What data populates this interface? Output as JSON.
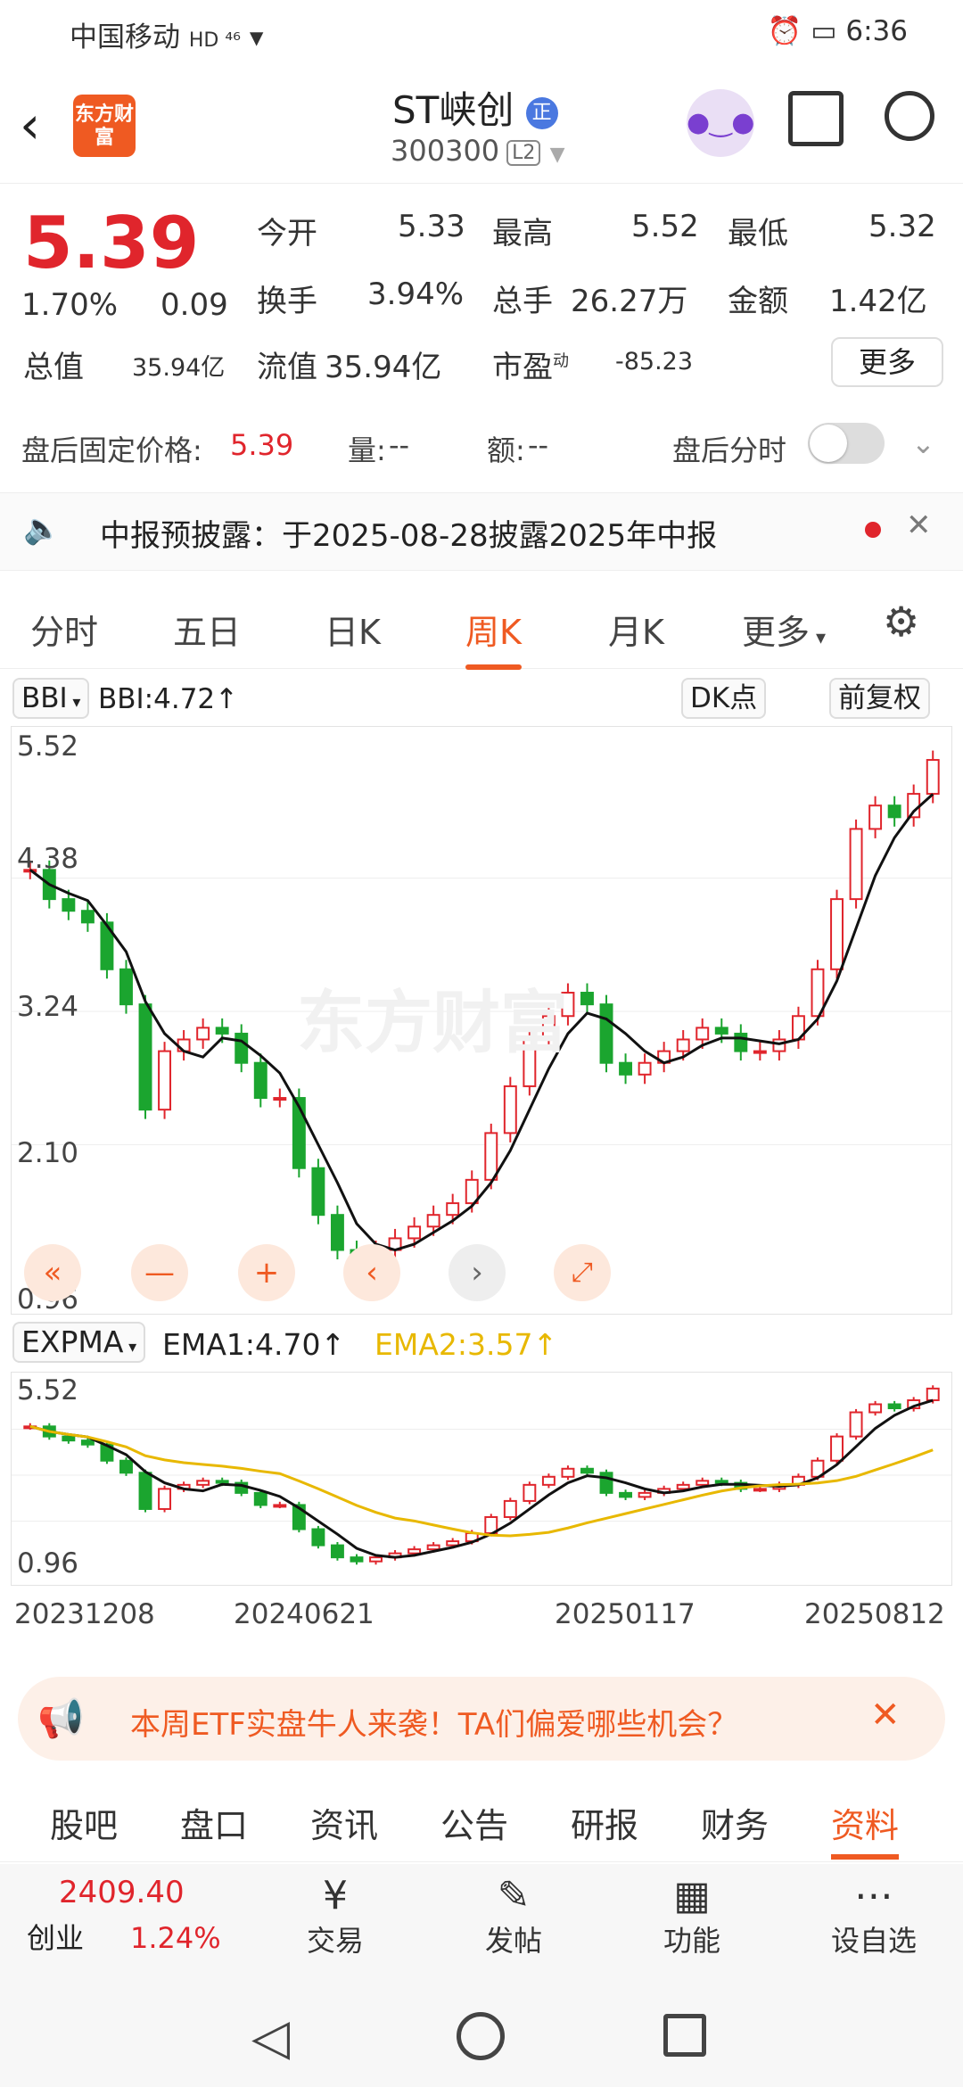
{
  "status_bar": {
    "carrier": "中国移动",
    "net": "HD ⁴⁶",
    "time": "6:36"
  },
  "header": {
    "logo_text": "东方财富",
    "stock_name": "ST峡创",
    "badge": "正",
    "stock_code": "300300",
    "level": "L2"
  },
  "quote": {
    "price": "5.39",
    "change_pct": "1.70%",
    "change_amt": "0.09",
    "open_label": "今开",
    "open": "5.33",
    "high_label": "最高",
    "high": "5.52",
    "low_label": "最低",
    "low": "5.32",
    "turnover_label": "换手",
    "turnover": "3.94%",
    "volume_label": "总手",
    "volume": "26.27万",
    "amount_label": "金额",
    "amount": "1.42亿",
    "mktcap_label": "总值",
    "mktcap": "35.94亿",
    "float_label": "流值",
    "float": "35.94亿",
    "pe_label": "市盈",
    "pe_sup": "动",
    "pe": "-85.23",
    "more": "更多"
  },
  "after_hours": {
    "label": "盘后固定价格:",
    "price": "5.39",
    "vol_label": "量:",
    "vol": "--",
    "amt_label": "额:",
    "amt": "--",
    "toggle_label": "盘后分时"
  },
  "notice": {
    "text": "中报预披露：于2025-08-28披露2025年中报"
  },
  "tabs": [
    "分时",
    "五日",
    "日K",
    "周K",
    "月K",
    "更多"
  ],
  "active_tab": "周K",
  "chart1": {
    "indicator": "BBI",
    "value_text": "BBI:4.72↑",
    "dk": "DK点",
    "adjust": "前复权",
    "ticks": [
      "5.52",
      "4.38",
      "3.24",
      "2.10",
      "0.96"
    ],
    "watermark": "东方财富"
  },
  "chart2": {
    "indicator": "EXPMA",
    "ema1": "EMA1:4.70↑",
    "ema2": "EMA2:3.57↑",
    "ticks": [
      "5.52",
      "0.96"
    ],
    "ema2_color": "#e8b800"
  },
  "dates": [
    "20231208",
    "20240621",
    "20250117",
    "20250812"
  ],
  "chart_data": {
    "type": "candlestick",
    "ylim": [
      0.96,
      5.52
    ],
    "bbi_last": 4.72,
    "ema1_last": 4.7,
    "ema2_last": 3.57,
    "close_path": [
      4.45,
      4.2,
      4.1,
      4.0,
      3.6,
      3.3,
      2.4,
      2.9,
      3.0,
      3.1,
      3.05,
      2.8,
      2.5,
      2.5,
      1.9,
      1.5,
      1.2,
      1.1,
      1.2,
      1.3,
      1.4,
      1.5,
      1.6,
      1.8,
      2.2,
      2.6,
      3.0,
      3.2,
      3.4,
      3.3,
      2.8,
      2.7,
      2.8,
      2.9,
      3.0,
      3.1,
      3.05,
      2.9,
      2.9,
      3.0,
      3.2,
      3.6,
      4.2,
      4.8,
      5.0,
      4.9,
      5.1,
      5.39
    ]
  },
  "promo": {
    "text": "本周ETF实盘牛人来袭！TA们偏爱哪些机会？"
  },
  "bottom_tabs": [
    "股吧",
    "盘口",
    "资讯",
    "公告",
    "研报",
    "财务",
    "资料"
  ],
  "active_bottom_tab": "资料",
  "bottom_nav": {
    "index_value": "2409.40",
    "index_name": "创业",
    "index_pct": "1.24%",
    "items": [
      "交易",
      "发帖",
      "功能",
      "设自选"
    ]
  }
}
